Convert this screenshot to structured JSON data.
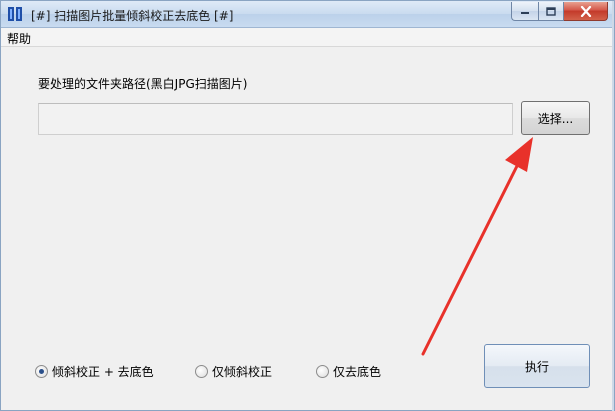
{
  "window": {
    "title": "[#] 扫描图片批量倾斜校正去底色 [#]"
  },
  "menu": {
    "items": [
      {
        "label": "帮助"
      }
    ]
  },
  "main": {
    "path_label": "要处理的文件夹路径(黑白JPG扫描图片)",
    "path_value": "",
    "choose_label": "选择...",
    "run_label": "执行",
    "options": [
      {
        "label": "倾斜校正 + 去底色",
        "selected": true
      },
      {
        "label": "仅倾斜校正",
        "selected": false
      },
      {
        "label": "仅去底色",
        "selected": false
      }
    ]
  },
  "colors": {
    "annotation_arrow": "#e8312a",
    "titlebar": "#c9dbef",
    "close_button": "#c33a2a"
  }
}
